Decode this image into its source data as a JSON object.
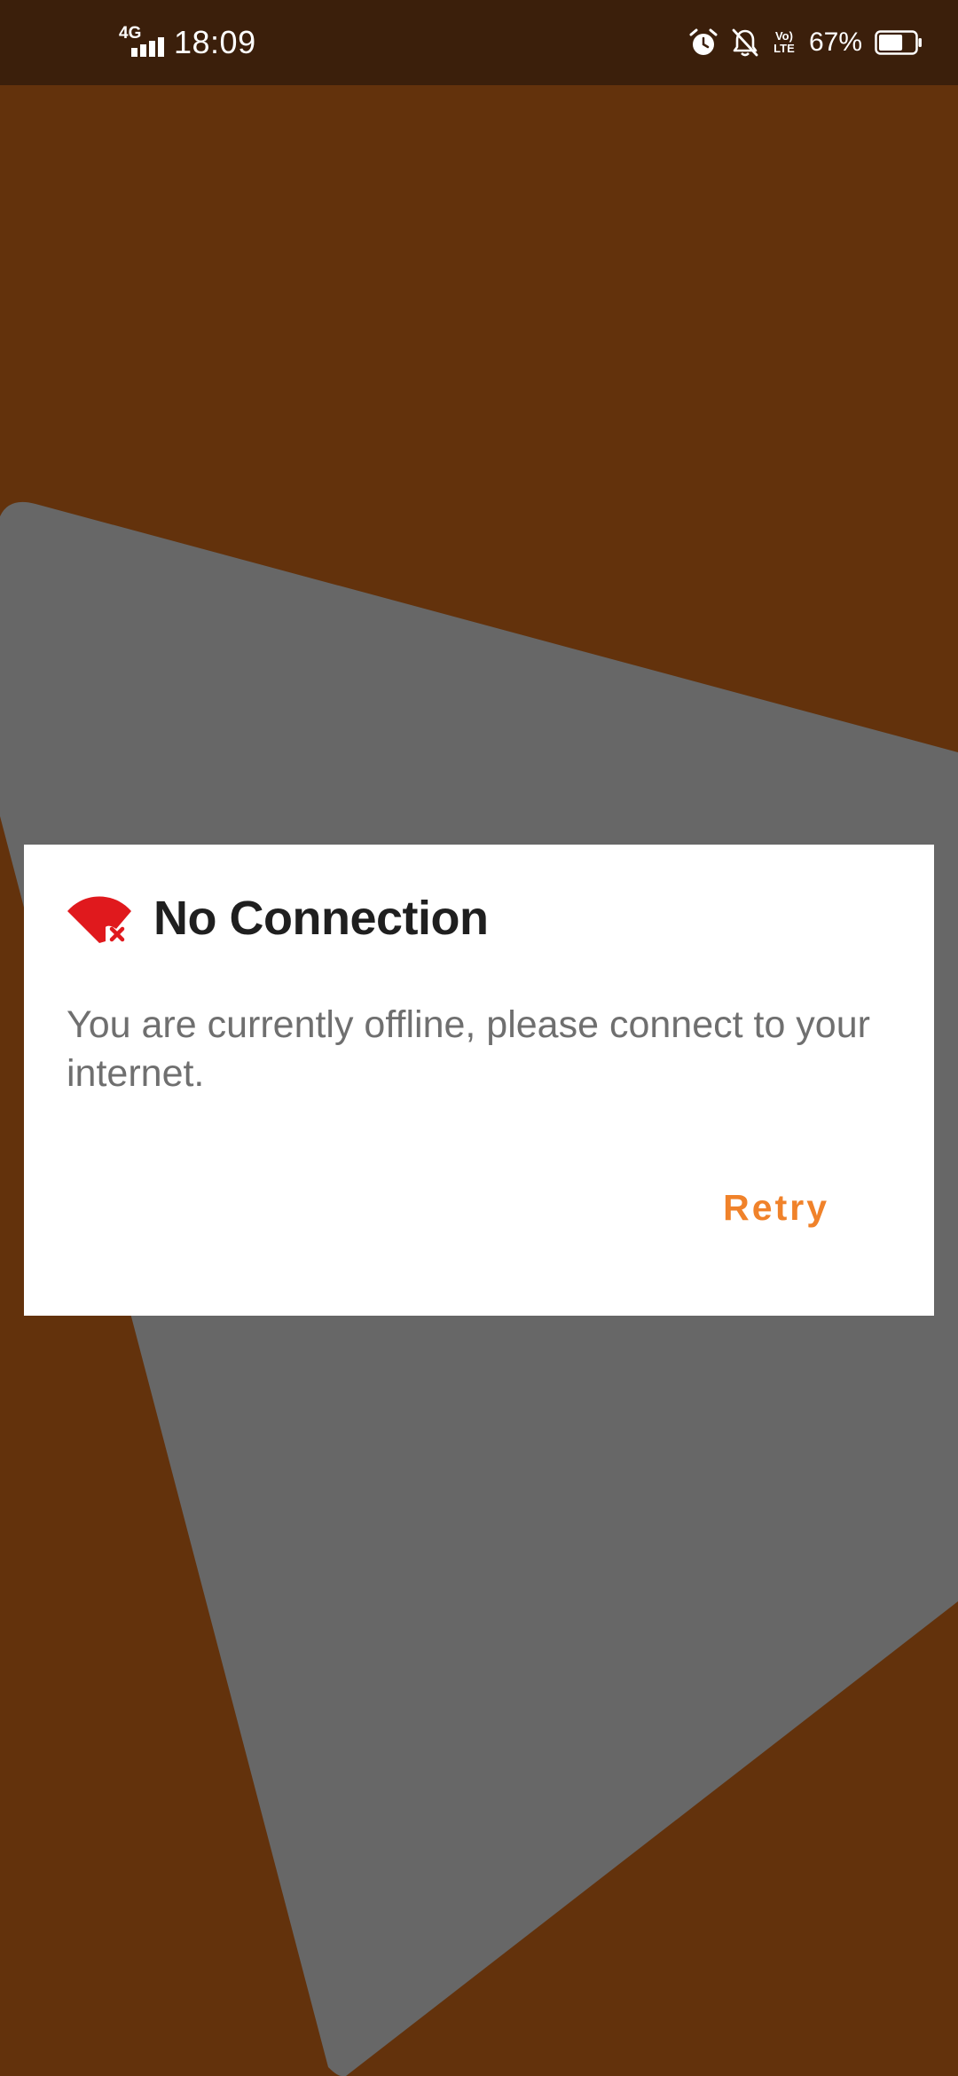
{
  "status_bar": {
    "network_type": "4G",
    "time": "18:09",
    "volte_top": "Vo)",
    "volte_bottom": "LTE",
    "battery_percent": "67%",
    "battery_level": 0.67,
    "icons": [
      "signal-icon",
      "alarm-icon",
      "notifications-off-icon",
      "volte-icon",
      "battery-icon"
    ]
  },
  "dialog": {
    "icon": "wifi-off-icon",
    "title": "No Connection",
    "message": "You are currently offline, please connect to your internet.",
    "retry_label": "Retry"
  },
  "colors": {
    "background": "#63320c",
    "status_bar": "#3b1f0b",
    "shape": "#676767",
    "icon_red": "#e0191d",
    "accent": "#f0822a",
    "title_text": "#1f1f1f",
    "message_text": "#6f6f6f"
  }
}
